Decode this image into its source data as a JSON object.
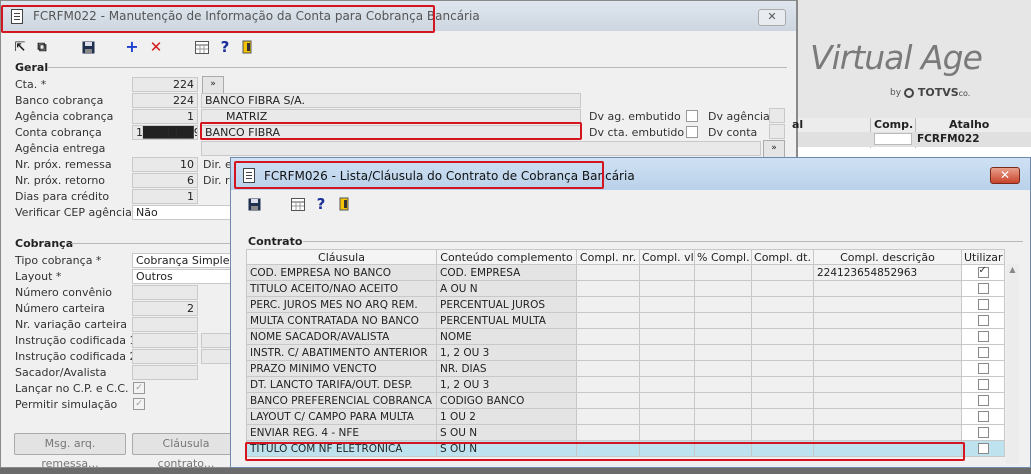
{
  "back_window": {
    "title": "FCRFM022 - Manutenção de Informação da Conta para Cobrança Bancária",
    "geral_section": "Geral",
    "fields": {
      "cta_label": "Cta. *",
      "cta_value": "224",
      "banco_label": "Banco cobrança",
      "banco_code": "224",
      "banco_name": "BANCO FIBRA S/A.",
      "agencia_label": "Agência cobrança",
      "agencia_code": "1",
      "agencia_name": "MATRIZ",
      "conta_label": "Conta cobrança",
      "conta_value": "1██████9",
      "conta_name": "BANCO FIBRA",
      "agencia_entrega_label": "Agência entrega",
      "nr_remessa_label": "Nr. próx. remessa",
      "nr_remessa_value": "10",
      "nr_retorno_label": "Nr. próx. retorno",
      "nr_retorno_value": "6",
      "dias_credito_label": "Dias para crédito",
      "dias_credito_value": "1",
      "verificar_cep_label": "Verificar CEP agência",
      "verificar_cep_value": "Não",
      "dir_env_label": "Dir. en",
      "dir_ret_label": "Dir. re",
      "dv_ag_embutido": "Dv ag. embutido",
      "dv_agencia": "Dv agência",
      "dv_cta_embutido": "Dv cta. embutido",
      "dv_conta": "Dv conta"
    },
    "cobranca_section": "Cobrança",
    "cobranca": {
      "tipo_label": "Tipo cobrança *",
      "tipo_value": "Cobrança Simples",
      "layout_label": "Layout *",
      "layout_value": "Outros",
      "convenio_label": "Número convênio",
      "carteira_label": "Número carteira",
      "carteira_value": "2",
      "variacao_label": "Nr. variação carteira",
      "instr1_label": "Instrução codificada 1",
      "instr2_label": "Instrução codificada 2",
      "sacador_label": "Sacador/Avalista",
      "lancar_label": "Lançar no C.P. e C.C.",
      "simulacao_label": "Permitir simulação"
    },
    "buttons": {
      "msg_remessa": "Msg. arq. remessa...",
      "clausula": "Cláusula contrato..."
    }
  },
  "virtual_age": {
    "logo_text": "Virtual Age",
    "by": "by",
    "totvs": "TOTVS",
    "co": "co.",
    "col_al": "al",
    "col_comp": "Comp.",
    "col_atalho": "Atalho",
    "atalho_value": "FCRFM022"
  },
  "front_window": {
    "title": "FCRFM026 - Lista/Cláusula do Contrato de Cobrança Bancária",
    "close_glyph": "✕",
    "contrato_section": "Contrato",
    "columns": [
      "Cláusula",
      "Conteúdo complemento",
      "Compl. nr.",
      "Compl. vl.",
      "% Compl.",
      "Compl. dt.",
      "Compl. descrição",
      "Utilizar"
    ],
    "rows": [
      {
        "clausula": "COD. EMPRESA NO BANCO",
        "conteudo": "COD. EMPRESA",
        "descricao": "224123654852963",
        "utilizar": true
      },
      {
        "clausula": "TITULO ACEITO/NAO ACEITO",
        "conteudo": "A OU N",
        "descricao": "",
        "utilizar": false
      },
      {
        "clausula": "PERC. JUROS MES NO ARQ REM.",
        "conteudo": "PERCENTUAL JUROS",
        "descricao": "",
        "utilizar": false
      },
      {
        "clausula": "MULTA CONTRATADA NO BANCO",
        "conteudo": "PERCENTUAL MULTA",
        "descricao": "",
        "utilizar": false
      },
      {
        "clausula": "NOME SACADOR/AVALISTA",
        "conteudo": "NOME",
        "descricao": "",
        "utilizar": false
      },
      {
        "clausula": "INSTR. C/ ABATIMENTO ANTERIOR",
        "conteudo": "1, 2 OU 3",
        "descricao": "",
        "utilizar": false
      },
      {
        "clausula": "PRAZO MINIMO VENCTO",
        "conteudo": "NR. DIAS",
        "descricao": "",
        "utilizar": false
      },
      {
        "clausula": "DT. LANCTO TARIFA/OUT. DESP.",
        "conteudo": "1, 2 OU 3",
        "descricao": "",
        "utilizar": false
      },
      {
        "clausula": "BANCO PREFERENCIAL COBRANCA",
        "conteudo": "CODIGO BANCO",
        "descricao": "",
        "utilizar": false
      },
      {
        "clausula": "LAYOUT C/ CAMPO PARA MULTA",
        "conteudo": "1 OU 2",
        "descricao": "",
        "utilizar": false
      },
      {
        "clausula": "ENVIAR REG. 4 - NFE",
        "conteudo": "S OU N",
        "descricao": "",
        "utilizar": false
      },
      {
        "clausula": "TITULO COM NF ELETRONICA",
        "conteudo": "S OU N",
        "descricao": "",
        "utilizar": false
      }
    ]
  }
}
